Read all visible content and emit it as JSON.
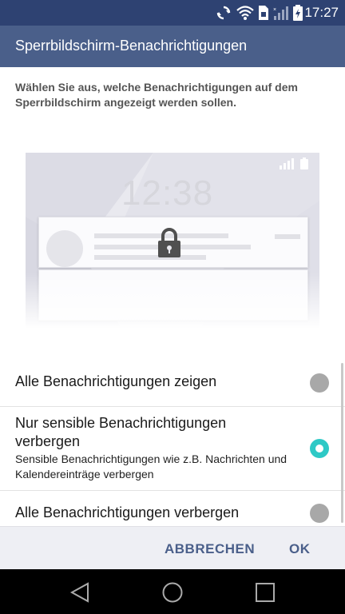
{
  "status_bar": {
    "time": "17:27",
    "icons": [
      "sync-icon",
      "wifi-icon",
      "sim-icon",
      "signal-icon",
      "battery-charging-icon"
    ]
  },
  "dialog": {
    "title": "Sperrbildschirm-Benachrichtigungen",
    "description": "Wählen Sie aus, welche Benachrichtigungen auf dem Sperrbildschirm angezeigt werden sollen.",
    "preview": {
      "time": "12:38",
      "icon": "lock-icon"
    },
    "options": [
      {
        "label": "Alle Benachrichtigungen zeigen",
        "selected": false
      },
      {
        "label": "Nur sensible Benachrichtigungen verbergen",
        "description": "Sensible Benachrichtigungen wie z.B. Nachrichten und Kalendereinträge verbergen",
        "selected": true
      },
      {
        "label": "Alle Benachrichtigungen verbergen",
        "selected": false
      }
    ],
    "buttons": {
      "cancel": "ABBRECHEN",
      "ok": "OK"
    }
  },
  "navigation": {
    "icons": [
      "back-icon",
      "home-icon",
      "recent-apps-icon"
    ]
  },
  "colors": {
    "status_bar": "#2e4272",
    "header": "#4a5f8a",
    "accent": "#2ec9c6",
    "button_text": "#4a5f8a"
  }
}
